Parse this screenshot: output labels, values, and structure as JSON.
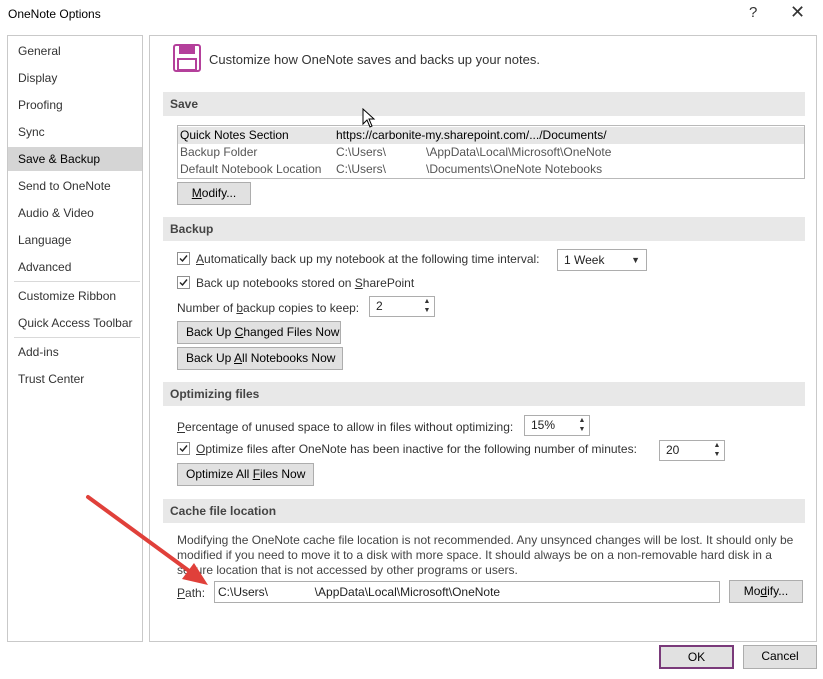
{
  "window": {
    "title": "OneNote Options",
    "help_glyph": "?",
    "close_glyph": "✕"
  },
  "sidebar": {
    "items": [
      {
        "label": "General"
      },
      {
        "label": "Display"
      },
      {
        "label": "Proofing"
      },
      {
        "label": "Sync"
      },
      {
        "label": "Save & Backup",
        "selected": true
      },
      {
        "label": "Send to OneNote"
      },
      {
        "label": "Audio & Video"
      },
      {
        "label": "Language"
      },
      {
        "label": "Advanced"
      },
      {
        "label": "Customize Ribbon"
      },
      {
        "label": "Quick Access Toolbar"
      },
      {
        "label": "Add-ins"
      },
      {
        "label": "Trust Center"
      }
    ]
  },
  "header": {
    "text": "Customize how OneNote saves and backs up your notes."
  },
  "save": {
    "heading": "Save",
    "rows": [
      {
        "name": "Quick Notes Section",
        "value": "https://carbonite-my.sharepoint.com/.../Documents/"
      },
      {
        "name": "Backup Folder",
        "value": "C:\\Users\\            \\AppData\\Local\\Microsoft\\OneNote"
      },
      {
        "name": "Default Notebook Location",
        "value": "C:\\Users\\            \\Documents\\OneNote Notebooks"
      }
    ],
    "modify_pre": "",
    "modify_key": "M",
    "modify_post": "odify..."
  },
  "backup": {
    "heading": "Backup",
    "auto_backup": {
      "pre": "",
      "key": "A",
      "post": "utomatically back up my notebook at the following time interval:",
      "checked": true
    },
    "interval_value": "1 Week",
    "sharepoint": {
      "pre": "Back up notebooks stored on ",
      "key": "S",
      "post": "harePoint",
      "checked": true
    },
    "copies": {
      "pre": "Number of ",
      "key": "b",
      "post": "ackup copies to keep:",
      "value": "2"
    },
    "changed_btn": {
      "pre": "Back Up ",
      "key": "C",
      "post": "hanged Files Now"
    },
    "all_btn": {
      "pre": "Back Up ",
      "key": "A",
      "post": "ll Notebooks Now"
    }
  },
  "optimizing": {
    "heading": "Optimizing files",
    "unused": {
      "pre": "",
      "key": "P",
      "post": "ercentage of unused space to allow in files without optimizing:",
      "value": "15%"
    },
    "after": {
      "pre": "",
      "key": "O",
      "post": "ptimize files after OneNote has been inactive for the following number of minutes:",
      "value": "20",
      "checked": true
    },
    "optimize_btn": {
      "pre": "Optimize All ",
      "key": "F",
      "post": "iles Now"
    }
  },
  "cache": {
    "heading": "Cache file location",
    "description": "Modifying the OneNote cache file location is not recommended. Any unsynced changes will be lost. It should only be modified if you need to move it to a disk with more space. It should always be on a non-removable hard disk in a secure location that is not accessed by other programs or users.",
    "path_pre": "",
    "path_key": "P",
    "path_post": "ath:",
    "path_value": "C:\\Users\\              \\AppData\\Local\\Microsoft\\OneNote",
    "modify_pre": "Mo",
    "modify_key": "d",
    "modify_post": "ify..."
  },
  "footer": {
    "ok_label": "OK",
    "cancel_label": "Cancel"
  },
  "colors": {
    "annotation_arrow": "#e0403a",
    "selected_nav": "#d5d5d5",
    "section_bar": "#e8e8e8",
    "icon_purple": "#b4409b"
  }
}
